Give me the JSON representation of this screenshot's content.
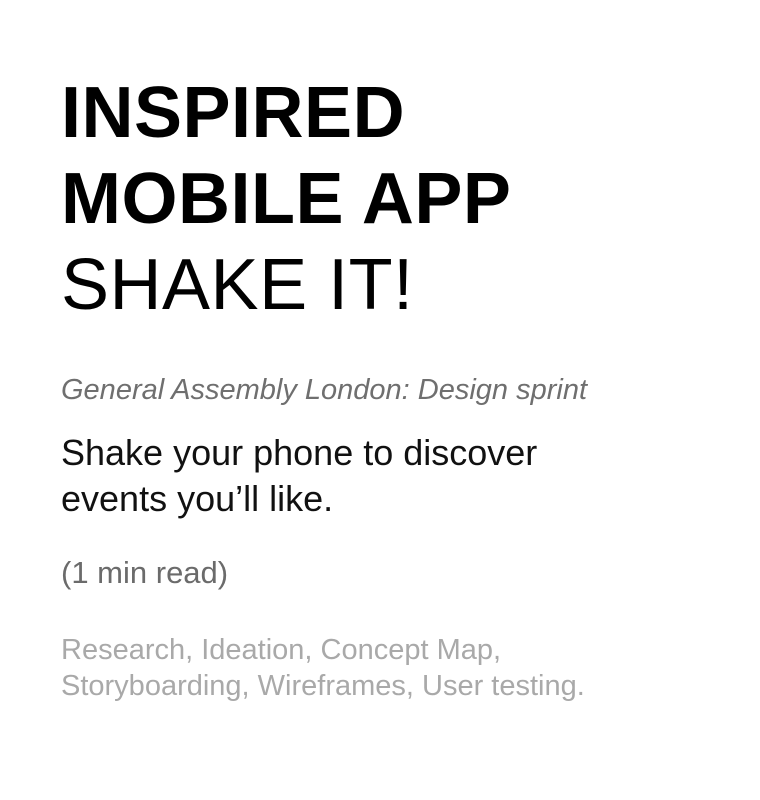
{
  "header": {
    "title_line_1": "INSPIRED",
    "title_line_2": "MOBILE APP",
    "title_line_3": "SHAKE IT!"
  },
  "subtitle": "General Assembly London: Design sprint",
  "lead": {
    "line_1": "Shake your phone to discover",
    "line_2": "events you’ll like."
  },
  "read_time": "(1 min read)",
  "skills": {
    "line_1": "Research, Ideation, Concept Map,",
    "line_2": "Storyboarding, Wireframes, User testing."
  }
}
